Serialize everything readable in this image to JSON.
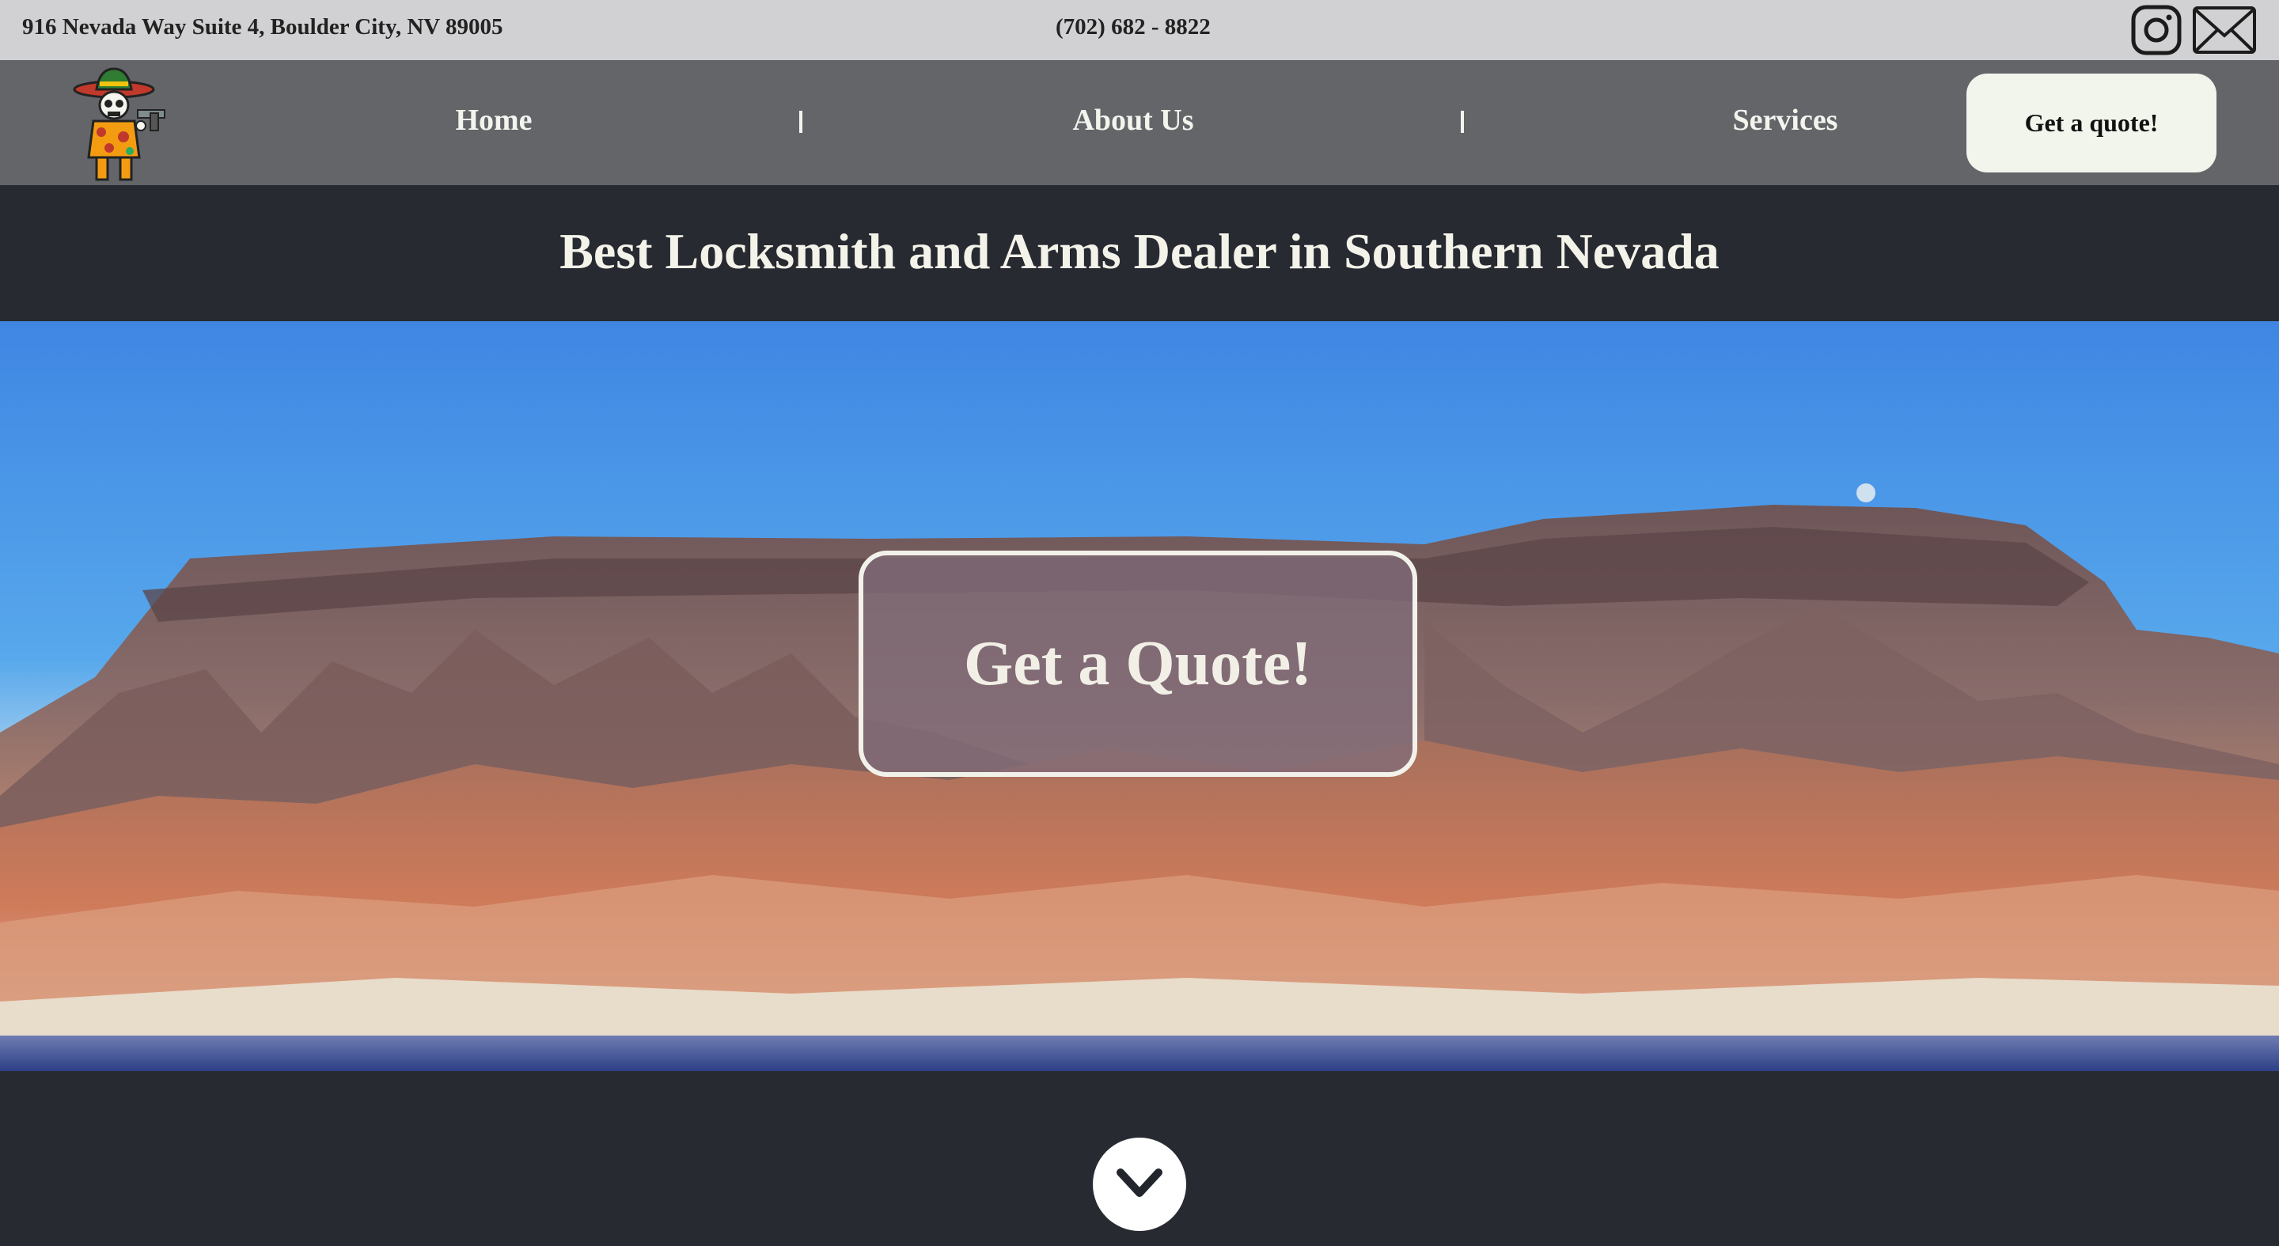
{
  "topbar": {
    "address": "916 Nevada Way Suite 4, Boulder City, NV 89005",
    "phone": "(702) 682 - 8822",
    "icons": [
      "instagram-icon",
      "mail-icon"
    ]
  },
  "nav": {
    "logo": "skeleton-gunslinger-logo",
    "links": [
      {
        "label": "Home"
      },
      {
        "label": "About Us"
      },
      {
        "label": "Services"
      }
    ],
    "quote_label": "Get a quote!"
  },
  "headline": "Best Locksmith and Arms Dealer in Southern Nevada",
  "hero": {
    "cta_label": "Get a Quote!",
    "scroll_icon": "chevron-down-icon"
  },
  "colors": {
    "topbar_bg": "#d1d0d2",
    "nav_bg": "#646569",
    "dark_bg": "#272a31",
    "button_bg": "#f1f5ec",
    "text_light": "#f3f3ea"
  }
}
